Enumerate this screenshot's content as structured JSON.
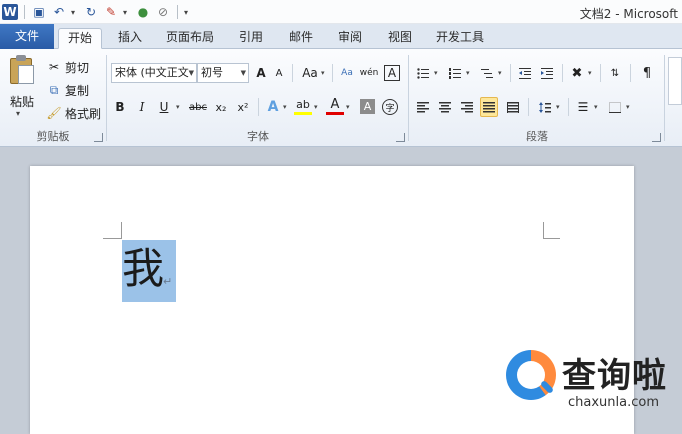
{
  "titlebar": {
    "title": "文档2 - Microsoft",
    "qat": {
      "word_logo": "W",
      "save": "💾",
      "undo": "↶",
      "redo": "↻",
      "paint": "🖌",
      "circle": "●",
      "clear": "⊘",
      "customize": "▾"
    }
  },
  "tabs": {
    "file": "文件",
    "items": [
      "开始",
      "插入",
      "页面布局",
      "引用",
      "邮件",
      "审阅",
      "视图",
      "开发工具"
    ]
  },
  "clipboard": {
    "paste_label": "粘贴",
    "cut_label": "剪切",
    "copy_label": "复制",
    "painter_label": "格式刷",
    "group_label": "剪贴板"
  },
  "font": {
    "font_name": "宋体 (中文正文",
    "font_size": "初号",
    "grow": "A",
    "shrink": "A",
    "case": "Aa",
    "clear_format": "Aa",
    "phonetic": "wén",
    "char_border": "A",
    "bold": "B",
    "italic": "I",
    "underline": "U",
    "strike": "abc",
    "subscript": "x₂",
    "superscript": "x²",
    "text_effect": "A",
    "highlight": "ab",
    "font_color": "A",
    "char_shading": "A",
    "enclose": "字",
    "group_label": "字体"
  },
  "paragraph": {
    "group_label": "段落"
  },
  "document": {
    "character": "我",
    "para_mark": "↵"
  },
  "watermark": {
    "text": "查询啦",
    "url": "chaxunla.com"
  },
  "colors": {
    "file_tab": "#2a5ba6",
    "selection": "#9bc2e8",
    "highlight_yellow": "#ffff00",
    "font_red": "#e00000"
  }
}
